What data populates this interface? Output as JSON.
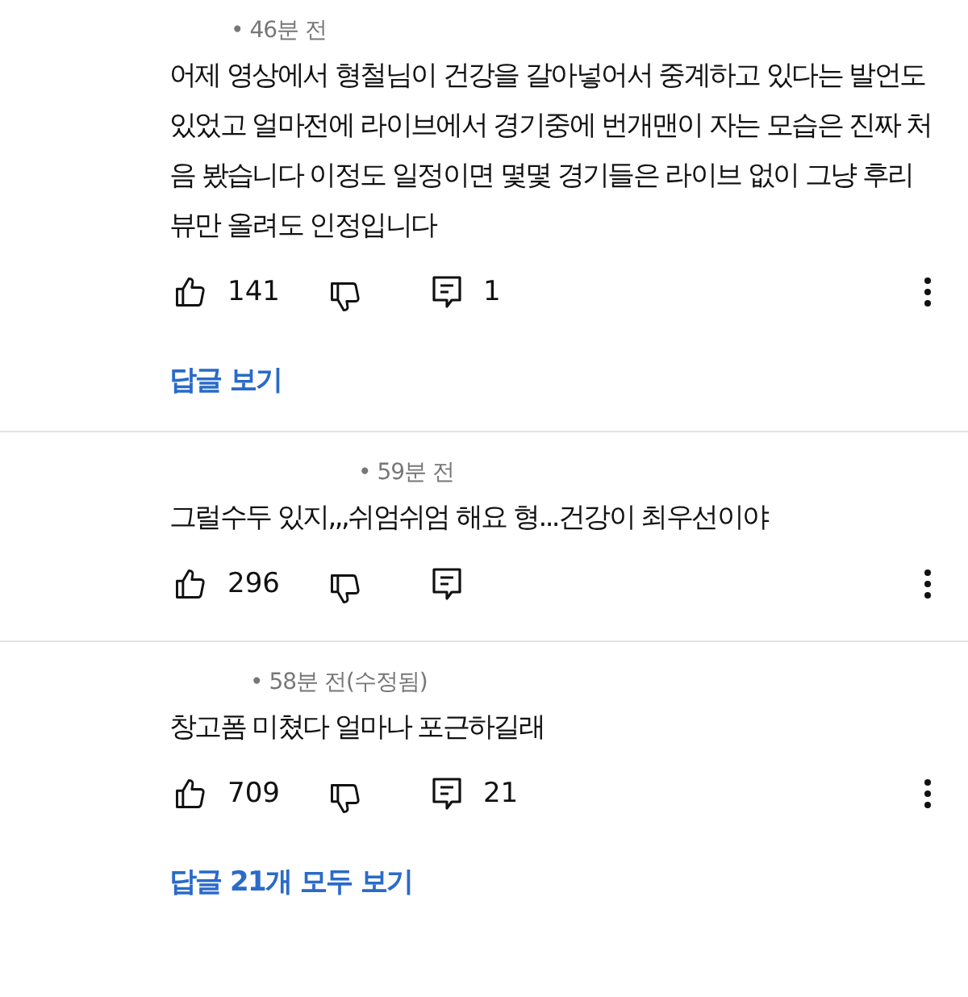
{
  "comments": [
    {
      "meta": "• 46분 전",
      "text": "어제 영상에서 형철님이 건강을 갈아넣어서 중계하고 있다는 발언도 있었고 얼마전에 라이브에서 경기중에 번개맨이 자는 모습은 진짜 처음 봤습니다 이정도 일정이면 몇몇 경기들은 라이브 없이 그냥 후리뷰만 올려도 인정입니다",
      "likes": "141",
      "reply_count": "1",
      "replies_link": "답글 보기"
    },
    {
      "meta": "• 59분 전",
      "text": "그럴수두 있지,,,쉬엄쉬엄 해요 형...건강이 최우선이야",
      "likes": "296"
    },
    {
      "meta": "• 58분 전(수정됨)",
      "text": "창고폼 미쳤다 얼마나 포근하길래",
      "likes": "709",
      "reply_count": "21",
      "replies_link": "답글 21개 모두 보기"
    }
  ]
}
